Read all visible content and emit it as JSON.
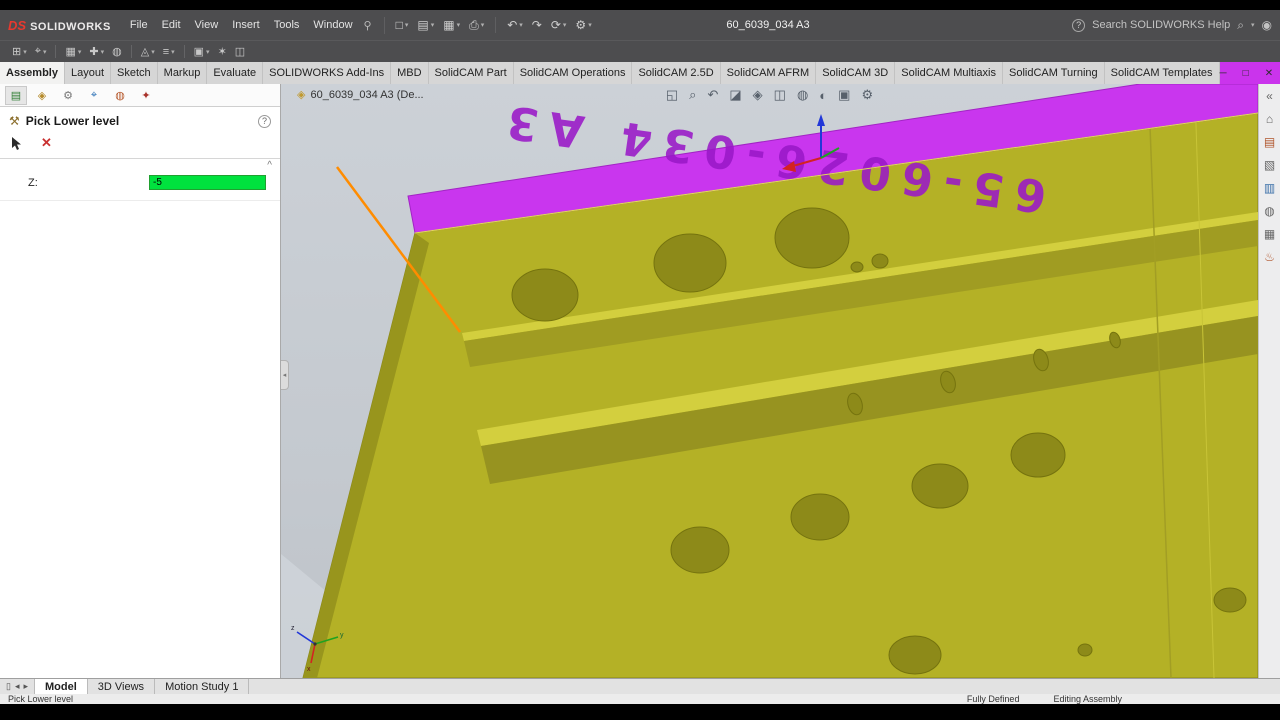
{
  "titlebar": {
    "logo_mark": "DS",
    "logo_text": "SOLIDWORKS",
    "menus": [
      "File",
      "Edit",
      "View",
      "Insert",
      "Tools",
      "Window"
    ],
    "document_title": "60_6039_034 A3",
    "help_search": "Search SOLIDWORKS Help"
  },
  "command_tabs": [
    "Assembly",
    "Layout",
    "Sketch",
    "Markup",
    "Evaluate",
    "SOLIDWORKS Add-Ins",
    "MBD",
    "SolidCAM Part",
    "SolidCAM Operations",
    "SolidCAM 2.5D",
    "SolidCAM AFRM",
    "SolidCAM 3D",
    "SolidCAM Multiaxis",
    "SolidCAM Turning",
    "SolidCAM Templates"
  ],
  "property_panel": {
    "title": "Pick Lower level",
    "z_label": "Z:",
    "z_value": "-5"
  },
  "viewport": {
    "breadcrumb": "60_6039_034 A3 (De...",
    "engraving": "65-6026-034 A3"
  },
  "bottom_tabs": [
    "Model",
    "3D Views",
    "Motion Study 1"
  ],
  "statusbar": {
    "message": "Pick Lower level",
    "state": "Fully Defined",
    "mode": "Editing Assembly"
  },
  "colors": {
    "model_yellow": "#b4b126",
    "model_magenta": "#c936ee",
    "selection_orange": "#ff8c00",
    "input_green": "#00e23e"
  },
  "icons": {
    "pin": "⚲",
    "caret": "▾",
    "new": "□",
    "open": "▤",
    "save": "▦",
    "print": "⎙",
    "undo": "↶",
    "redo": "↷",
    "rebuild": "⟳",
    "settings": "⚙",
    "help": "?",
    "search": "⌕",
    "user": "◉",
    "insert_components": "⊞",
    "mate": "⌖",
    "pattern": "▦",
    "move_component": "✚",
    "show_hidden": "◍",
    "assembly_features": "◬",
    "reference_geometry": "≡",
    "bom": "▣",
    "exploded_view": "✶",
    "smart_fasteners": "◫",
    "zoom_fit": "◱",
    "zoom_area": "⌕",
    "previous_view": "↶",
    "section_view": "◪",
    "view_orientation": "◈",
    "display_style": "◫",
    "hide_show": "◍",
    "appearance": "◐",
    "scene": "▣",
    "view_settings": "⚙",
    "fm_tab": "▤",
    "pm_tab": "◈",
    "cfg_tab": "⚙",
    "dim_tab": "⌖",
    "disp_tab": "◍",
    "cam_tab": "✦",
    "collapse": "«",
    "sw_resources": "⌂",
    "design_library": "▤",
    "file_explorer": "▧",
    "view_palette": "▥",
    "appearances": "◍",
    "custom_properties": "▦",
    "solidcam": "♨",
    "window_split": "▯",
    "nav_left": "◂",
    "nav_right": "▸",
    "minimize": "─",
    "restore": "□",
    "close": "✕",
    "crumb": "◈",
    "chevron_up": "^",
    "cancel": "✕",
    "pm_header": "⚒"
  }
}
